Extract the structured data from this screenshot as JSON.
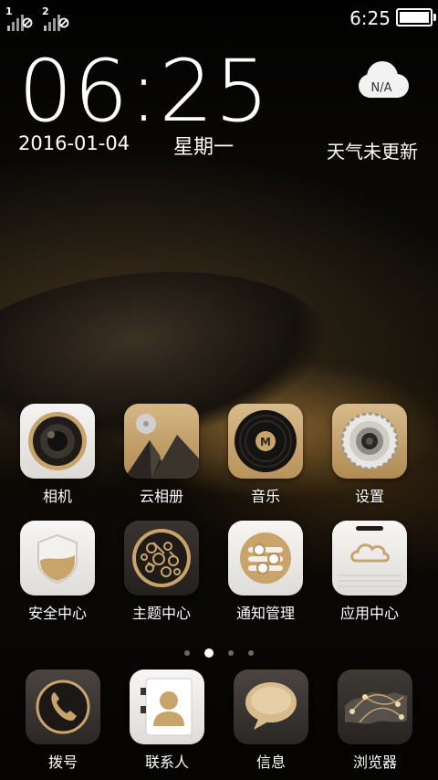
{
  "status_bar": {
    "sim1_label": "1",
    "sim2_label": "2",
    "time": "6:25",
    "battery_level": 1.0
  },
  "lock_widget": {
    "clock": "06:25",
    "date": "2016-01-04",
    "weekday": "星期一",
    "weather_temp": "N/A",
    "weather_status": "天气未更新"
  },
  "apps_row1": [
    {
      "label": "相机",
      "icon": "camera-icon"
    },
    {
      "label": "云相册",
      "icon": "cloud-album-icon"
    },
    {
      "label": "音乐",
      "icon": "music-icon"
    },
    {
      "label": "设置",
      "icon": "settings-gear-icon"
    }
  ],
  "apps_row2": [
    {
      "label": "安全中心",
      "icon": "shield-icon"
    },
    {
      "label": "主题中心",
      "icon": "theme-icon"
    },
    {
      "label": "通知管理",
      "icon": "notification-manager-icon"
    },
    {
      "label": "应用中心",
      "icon": "app-center-icon"
    }
  ],
  "page_indicator": {
    "count": 4,
    "active_index": 1
  },
  "dock": [
    {
      "label": "拨号",
      "icon": "phone-icon"
    },
    {
      "label": "联系人",
      "icon": "contacts-icon"
    },
    {
      "label": "信息",
      "icon": "message-icon"
    },
    {
      "label": "浏览器",
      "icon": "browser-globe-icon"
    }
  ],
  "colors": {
    "accent_gold": "#c9a46a",
    "icon_light": "#ecebe8",
    "icon_dark": "#2b2622"
  }
}
